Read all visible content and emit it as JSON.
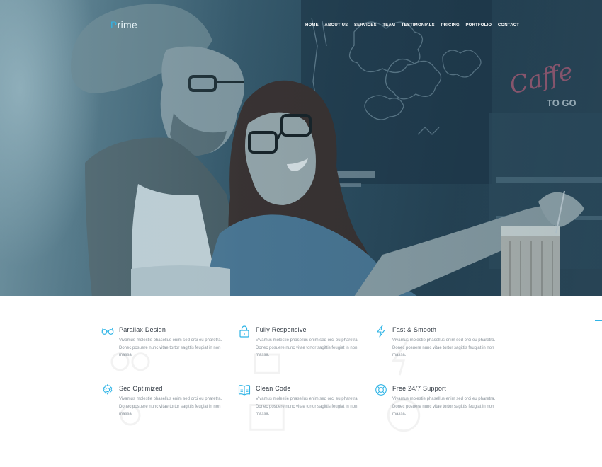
{
  "brand": {
    "first_letter": "P",
    "rest": "rime",
    "accent_color": "#2fb4e6"
  },
  "nav": {
    "items": [
      "HOME",
      "ABOUT US",
      "SERVICES",
      "TEAM",
      "TESTIMONIALS",
      "PRICING",
      "PORTFOLIO",
      "CONTACT"
    ]
  },
  "hero": {
    "sign_text": "Caffe",
    "sign_sub": "TO GO"
  },
  "features": [
    {
      "icon": "glasses-icon",
      "title": "Parallax Design",
      "text": "Vivamus molestie phasellus enim sed orci eu pharetra. Donec posuere nunc vitae tortor sagittis feugiat in non massa."
    },
    {
      "icon": "lock-icon",
      "title": "Fully Responsive",
      "text": "Vivamus molestie phasellus enim sed orci eu pharetra. Donec posuere nunc vitae tortor sagittis feugiat in non massa."
    },
    {
      "icon": "lightning-icon",
      "title": "Fast & Smooth",
      "text": "Vivamus molestie phasellus enim sed orci eu pharetra. Donec posuere nunc vitae tortor sagittis feugiat in non massa."
    },
    {
      "icon": "gear-icon",
      "title": "Seo Optimized",
      "text": "Vivamus molestie phasellus enim sed orci eu pharetra. Donec posuere nunc vitae tortor sagittis feugiat in non massa."
    },
    {
      "icon": "book-icon",
      "title": "Clean Code",
      "text": "Vivamus molestie phasellus enim sed orci eu pharetra. Donec posuere nunc vitae tortor sagittis feugiat in non massa."
    },
    {
      "icon": "lifebuoy-icon",
      "title": "Free 24/7 Support",
      "text": "Vivamus molestie phasellus enim sed orci eu pharetra. Donec posuere nunc vitae tortor sagittis feugiat in non massa."
    }
  ]
}
